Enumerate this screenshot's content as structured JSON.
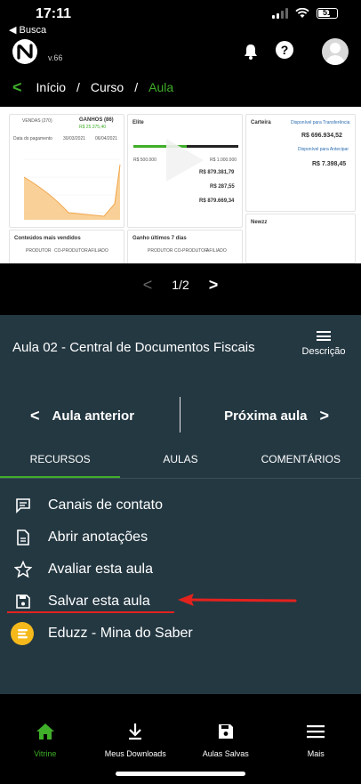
{
  "status_bar": {
    "time": "17:11",
    "back_label": "◀ Busca",
    "battery": "51"
  },
  "header": {
    "version": "v.66"
  },
  "breadcrumb": {
    "home": "Início",
    "separator": "/",
    "course": "Curso",
    "current": "Aula"
  },
  "preview": {
    "vendas_tab": "VENDAS (270)",
    "ganhos_tab": "GANHOS (86)",
    "ganhos_value": "R$ 25.375,40",
    "date_label": "Data do pagamento",
    "date_from": "30/03/2021",
    "date_to": "06/04/2021",
    "elite_title": "Elite",
    "elite_amount_1": "R$ 500.000",
    "elite_amount_2": "R$ 1.000.000",
    "juros": "R$ 879.381,79",
    "afiliado": "R$ 287,55",
    "total": "R$ 879.669,34",
    "carteira_title": "Carteira",
    "disponivel": "R$ 696.934,52",
    "disponivel_label": "Disponível para Transferência",
    "antecipar": "R$ 7.398,45",
    "antecipar_label": "Disponível para Antecipar",
    "newzz": "Newzz",
    "conteudos": "Conteúdos mais vendidos",
    "ganho7": "Ganho últimos 7 dias",
    "produtor": "PRODUTOR",
    "coprodutor": "CO-PRODUTOR",
    "afiliado_tab": "AFILIADO"
  },
  "pager": {
    "page": "1/2"
  },
  "lesson": {
    "title": "Aula 02 - Central de Documentos Fiscais",
    "description_label": "Descrição",
    "prev_label": "Aula anterior",
    "next_label": "Próxima aula"
  },
  "tabs": [
    {
      "label": "RECURSOS",
      "active": true
    },
    {
      "label": "AULAS",
      "active": false
    },
    {
      "label": "COMENTÁRIOS",
      "active": false
    }
  ],
  "resources": [
    {
      "label": "Canais de contato",
      "icon": "chat-icon"
    },
    {
      "label": "Abrir anotações",
      "icon": "note-icon"
    },
    {
      "label": "Avaliar esta aula",
      "icon": "star-icon"
    },
    {
      "label": "Salvar esta aula",
      "icon": "save-icon"
    },
    {
      "label": "Eduzz - Mina do Saber",
      "icon": "eduzz-logo-icon"
    }
  ],
  "bottom_nav": [
    {
      "label": "Vitrine",
      "icon": "home-icon",
      "active": true
    },
    {
      "label": "Meus Downloads",
      "icon": "download-icon",
      "active": false
    },
    {
      "label": "Aulas Salvas",
      "icon": "save-icon",
      "active": false
    },
    {
      "label": "Mais",
      "icon": "menu-icon",
      "active": false
    }
  ],
  "colors": {
    "accent": "#3fae29",
    "panel": "#243842",
    "annotation": "#e3221e"
  }
}
